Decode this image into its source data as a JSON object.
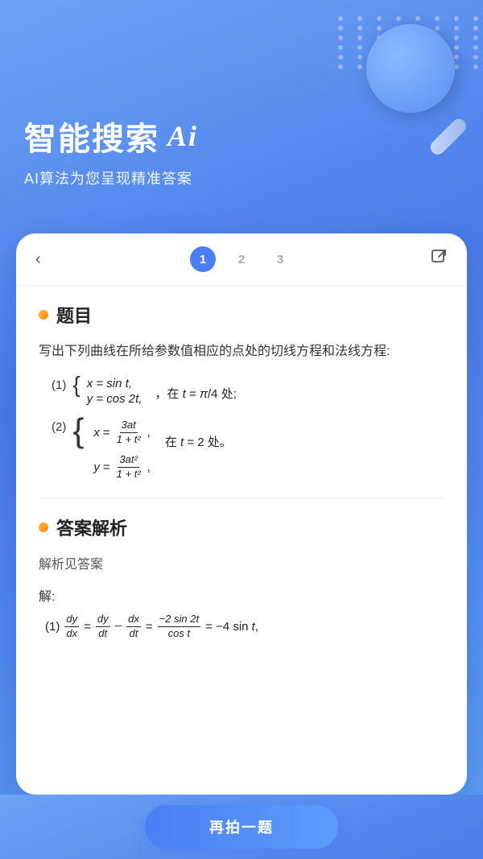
{
  "app": {
    "title": "智能搜索",
    "ai_label": "Ai",
    "subtitle": "AI算法为您呈现精准答案"
  },
  "nav": {
    "back_label": "‹",
    "share_label": "⬡",
    "pages": [
      "1",
      "2",
      "3"
    ],
    "active_page": 0
  },
  "problem_section": {
    "dot_color": "#FFB347",
    "title": "题目",
    "description": "写出下列曲线在所给参数值相应的点处的切线方程和法线方程:",
    "problem_1_label": "(1)  {",
    "problem_1_eq1": "x = sin t,",
    "problem_1_eq2": "y = cos 2t,",
    "problem_1_condition": "，在 t = π/4 处;",
    "problem_2_label": "(2)  {",
    "problem_2_eq1": "x = 3at / (1+t²),",
    "problem_2_eq2": "y = 3at² / (1+t²),",
    "problem_2_condition": "在 t = 2 处。"
  },
  "answer_section": {
    "dot_color": "#FFB347",
    "title": "答案解析",
    "note": "解析见答案",
    "solution_label": "解:",
    "solution_1": "(1) dy/dx = (dy/dt)/(dx/dt) = −2sin2t / cost = −4sin t,"
  },
  "bottom": {
    "retake_label": "再拍一题"
  }
}
